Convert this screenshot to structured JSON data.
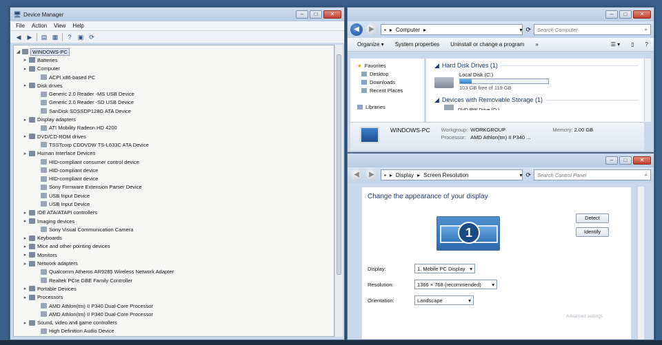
{
  "device_manager": {
    "title": "Device Manager",
    "menu": [
      "File",
      "Action",
      "View",
      "Help"
    ],
    "tree": [
      {
        "label": "WINDOWS-PC",
        "level": 0
      },
      {
        "label": "Batteries",
        "level": 1
      },
      {
        "label": "Computer",
        "level": 1
      },
      {
        "label": "ACPI x86-based PC",
        "level": 2
      },
      {
        "label": "Disk drives",
        "level": 1
      },
      {
        "label": "Generic 2.0 Reader  -MS USB Device",
        "level": 2
      },
      {
        "label": "Generic 2.0 Reader  -SD USB Device",
        "level": 2
      },
      {
        "label": "SanDisk SDSSDP128G ATA Device",
        "level": 2
      },
      {
        "label": "Display adapters",
        "level": 1
      },
      {
        "label": "ATI Mobility Radeon HD 4200",
        "level": 2
      },
      {
        "label": "DVD/CD-ROM drives",
        "level": 1
      },
      {
        "label": "TSSTcorp CDDVDW TS-L633C ATA Device",
        "level": 2
      },
      {
        "label": "Human Interface Devices",
        "level": 1
      },
      {
        "label": "HID-compliant consumer control device",
        "level": 2
      },
      {
        "label": "HID-compliant device",
        "level": 2
      },
      {
        "label": "HID-compliant device",
        "level": 2
      },
      {
        "label": "Sony Firmware Extension Parser Device",
        "level": 2
      },
      {
        "label": "USB Input Device",
        "level": 2
      },
      {
        "label": "USB Input Device",
        "level": 2
      },
      {
        "label": "IDE ATA/ATAPI controllers",
        "level": 1
      },
      {
        "label": "Imaging devices",
        "level": 1
      },
      {
        "label": "Sony Visual Communication Camera",
        "level": 2
      },
      {
        "label": "Keyboards",
        "level": 1
      },
      {
        "label": "Mice and other pointing devices",
        "level": 1
      },
      {
        "label": "Monitors",
        "level": 1
      },
      {
        "label": "Network adapters",
        "level": 1
      },
      {
        "label": "Qualcomm Atheros AR9285 Wireless Network Adapter",
        "level": 2
      },
      {
        "label": "Realtek PCIe GBE Family Controller",
        "level": 2
      },
      {
        "label": "Portable Devices",
        "level": 1
      },
      {
        "label": "Processors",
        "level": 1
      },
      {
        "label": "AMD Athlon(tm) II P340 Dual-Core Processor",
        "level": 2
      },
      {
        "label": "AMD Athlon(tm) II P340 Dual-Core Processor",
        "level": 2
      },
      {
        "label": "Sound, video and game controllers",
        "level": 1
      },
      {
        "label": "High Definition Audio Device",
        "level": 2
      }
    ]
  },
  "computer": {
    "breadcrumb": "Computer",
    "search_placeholder": "Search Computer",
    "commands": [
      "Organize ▾",
      "System properties",
      "Uninstall or change a program",
      "»"
    ],
    "nav": [
      "Favorites",
      "Desktop",
      "Downloads",
      "Recent Places",
      "Libraries"
    ],
    "hdd_header": "Hard Disk Drives (1)",
    "disk_name": "Local Disk (C:)",
    "disk_used_fraction": 0.13,
    "disk_free": "103 GB free of 119 GB",
    "removable_header": "Devices with Removable Storage (1)",
    "removable_partial": "DVD RW Drive (D:)",
    "pc_name": "WINDOWS-PC",
    "workgroup_label": "Workgroup:",
    "workgroup": "WORKGROUP",
    "memory_label": "Memory:",
    "memory": "2.00 GB",
    "processor_label": "Processor:",
    "processor": "AMD Athlon(tm) II P340 ..."
  },
  "display": {
    "crumb1": "Display",
    "crumb2": "Screen Resolution",
    "search_placeholder": "Search Control Panel",
    "heading": "Change the appearance of your display",
    "monitor_number": "1",
    "detect": "Detect",
    "identify": "Identify",
    "display_label": "Display:",
    "display_value": "1. Mobile PC Display",
    "resolution_label": "Resolution:",
    "resolution_value": "1366 × 768 (recommended)",
    "orientation_label": "Orientation:",
    "orientation_value": "Landscape",
    "advanced": "Advanced settings"
  },
  "colors": {
    "window_frame": "#c9d8ea",
    "desktop": "#3a5f8a",
    "accent": "#2f7fc8"
  }
}
